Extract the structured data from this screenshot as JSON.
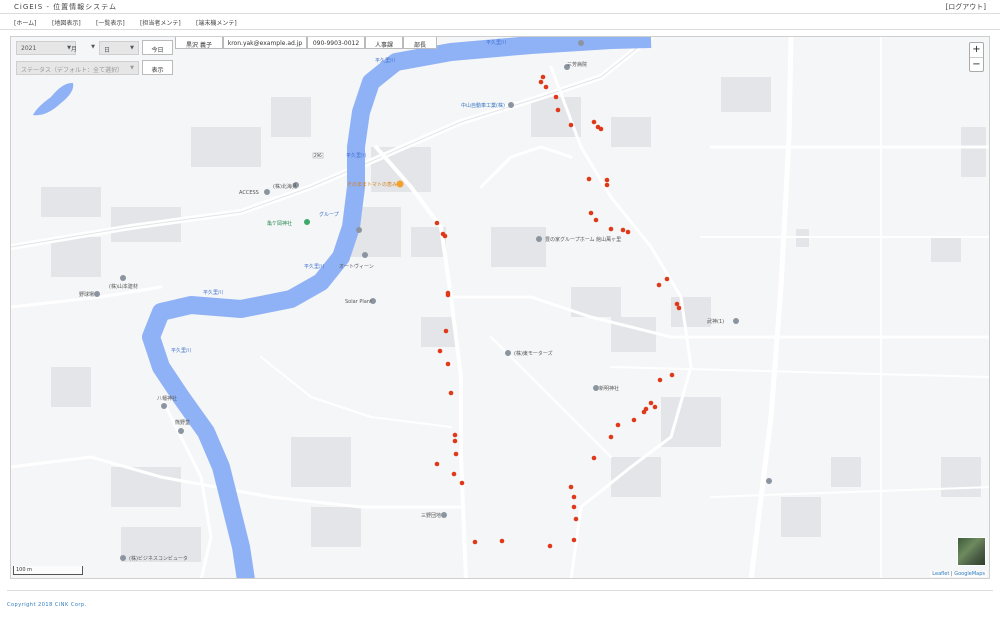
{
  "header": {
    "app_title": "CiGEIS - 位置情報システム",
    "logout_label": "[ログアウト]"
  },
  "nav": [
    {
      "label": "[ホーム]"
    },
    {
      "label": "[地図表示]"
    },
    {
      "label": "[一覧表示]"
    },
    {
      "label": "[担当者メンテ]"
    },
    {
      "label": "[端末機メンテ]"
    }
  ],
  "controls": {
    "year": "2021",
    "month": "月",
    "day": "日",
    "today_button": "今日",
    "status_placeholder": "ステータス（デフォルト：全て選択）",
    "display_button": "表示"
  },
  "info": {
    "name": "黒沢 義子",
    "email": "kron.yak@example.ad.jp",
    "phone": "090-9903-0012",
    "department": "人事課",
    "position": "部長"
  },
  "map": {
    "zoom_in": "+",
    "zoom_out": "−",
    "scale_label": "100 m",
    "attribution_leaflet": "Leaflet",
    "attribution_sep": "|",
    "attribution_google": "GoogleMaps",
    "marker_color": "#e0391a",
    "river_color": "#8fb1f6",
    "labels": {
      "river1": "平久里川",
      "river2": "平久里川",
      "river3": "平久里川",
      "river4": "平久里川",
      "river5": "平久里川",
      "river6": "平久里川",
      "place_sanwa": "三芳病院",
      "place_nakayama": "中山自動車工業(株)",
      "place_shiro": "(株)北海見",
      "place_accessory": "ACCESS",
      "place_kamegaoka": "亀ケ岡神社",
      "place_tomato": "そのままトマトの恵み",
      "place_group": "グループ",
      "place_ootani": "(株)山本建材",
      "place_ouren": "オートヴィーン",
      "place_sola": "Solar Plant",
      "place_yakyu": "野球場",
      "place_group2": "豊の家グループホーム 館山萬ヶ里",
      "place_ltd": "(株)東モーターズ",
      "place_mishima": "武神(1)",
      "place_shinmei": "新明神社",
      "place_hachiman": "八幡神社",
      "place_kumano": "熊野堂",
      "place_sanyo": "三野団地",
      "place_business": "(株)ビジネスコンビュータ",
      "route_number": "296"
    }
  },
  "footer": {
    "copyright": "Copyright 2018 CiNK Corp."
  }
}
